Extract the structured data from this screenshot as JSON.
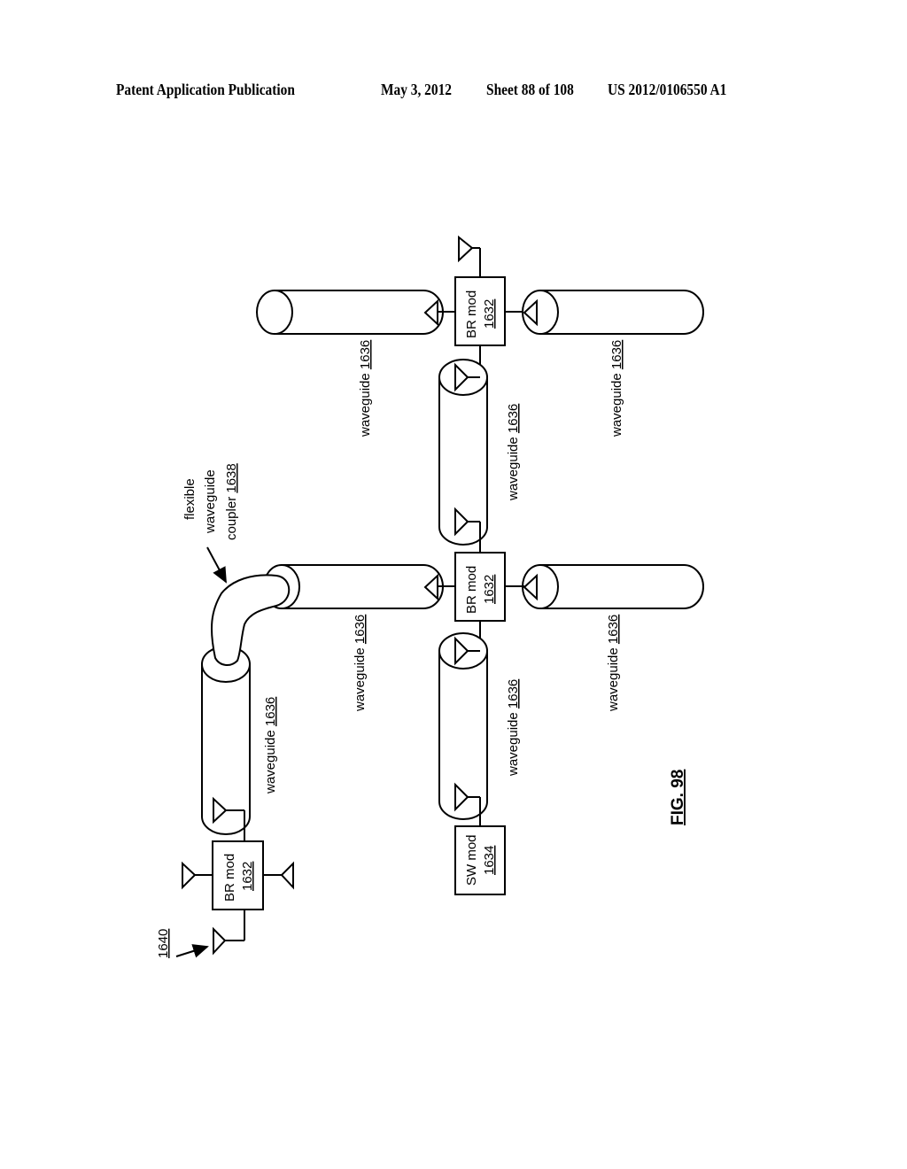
{
  "header": {
    "publication": "Patent Application Publication",
    "date": "May 3, 2012",
    "sheet": "Sheet 88 of 108",
    "number": "US 2012/0106550 A1"
  },
  "figure": {
    "label": "FIG. 98",
    "waveguide": {
      "text": "waveguide ",
      "ref": "1636"
    },
    "br_mod": {
      "text": "BR mod",
      "ref": "1632"
    },
    "sw_mod": {
      "text": "SW mod",
      "ref": "1634"
    },
    "coupler": {
      "line1": "flexible",
      "line2": "waveguide",
      "line3": "coupler ",
      "ref": "1638"
    },
    "system_ref": "1640"
  }
}
